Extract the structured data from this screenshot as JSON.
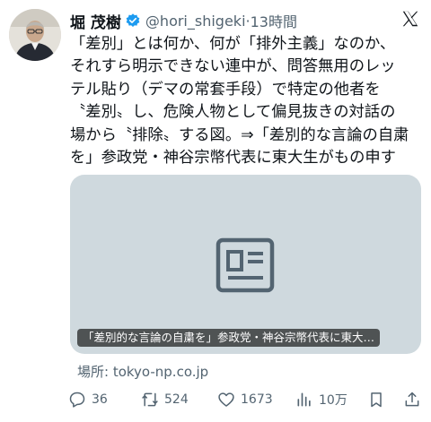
{
  "author": {
    "display_name": "堀 茂樹",
    "handle": "@hori_shigeki",
    "separator": "·",
    "time": "13時間",
    "verified_icon": "verified-badge-icon",
    "avatar_icon": "avatar-photo"
  },
  "tweet": {
    "lines": [
      "「差別」とは何か、何が「排外主義」なのか、",
      "それすら明示できない連中が、問答無用のレッ",
      "テル貼り（デマの常套手段）で特定の他者を",
      "〝差別〟し、危険人物として偏見抜きの対話の",
      "場から〝排除〟する図。⇒「差別的な言論の自粛",
      "を」参政党・神谷宗幣代表に東大生がもの申す"
    ]
  },
  "card": {
    "icon": "article-card-icon",
    "caption": "「差別的な言論の自粛を」参政党・神谷宗幣代表に東大…",
    "source": "場所: tokyo-np.co.jp"
  },
  "actions": {
    "replies": "36",
    "reposts": "524",
    "likes": "1673",
    "views": "10万"
  },
  "colors": {
    "text": "#0f1419",
    "secondary": "#536471",
    "verified": "#1d9bf0",
    "card_bg": "#cfd9de"
  }
}
